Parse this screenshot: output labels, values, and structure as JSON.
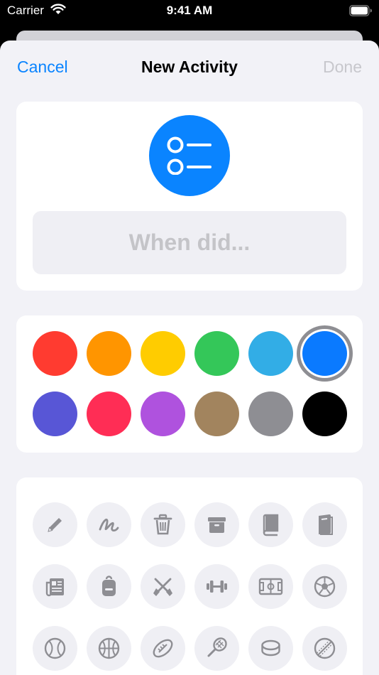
{
  "status_bar": {
    "carrier": "Carrier",
    "time": "9:41 AM"
  },
  "nav": {
    "cancel_label": "Cancel",
    "title": "New Activity",
    "done_label": "Done"
  },
  "activity": {
    "icon": "list-bullet-icon",
    "icon_color": "#0a84ff",
    "name_value": "",
    "name_placeholder": "When did..."
  },
  "colors": [
    {
      "name": "red",
      "hex": "#ff3b30",
      "selected": false
    },
    {
      "name": "orange",
      "hex": "#ff9500",
      "selected": false
    },
    {
      "name": "yellow",
      "hex": "#ffcc00",
      "selected": false
    },
    {
      "name": "green",
      "hex": "#34c759",
      "selected": false
    },
    {
      "name": "cyan",
      "hex": "#32ade6",
      "selected": false
    },
    {
      "name": "blue",
      "hex": "#0a7aff",
      "selected": true
    },
    {
      "name": "indigo",
      "hex": "#5856d6",
      "selected": false
    },
    {
      "name": "pink",
      "hex": "#ff2d55",
      "selected": false
    },
    {
      "name": "purple",
      "hex": "#af52de",
      "selected": false
    },
    {
      "name": "brown",
      "hex": "#a2845e",
      "selected": false
    },
    {
      "name": "gray",
      "hex": "#8e8e93",
      "selected": false
    },
    {
      "name": "black",
      "hex": "#000000",
      "selected": false
    }
  ],
  "icons": [
    "pencil-icon",
    "scribble-icon",
    "trash-icon",
    "archivebox-icon",
    "book-icon",
    "notebook-icon",
    "newspaper-icon",
    "backpack-icon",
    "oars-icon",
    "dumbbell-icon",
    "sports-court-icon",
    "soccer-ball-icon",
    "baseball-icon",
    "basketball-icon",
    "football-icon",
    "tennis-racket-icon",
    "hockey-puck-icon",
    "cricket-ball-icon"
  ]
}
